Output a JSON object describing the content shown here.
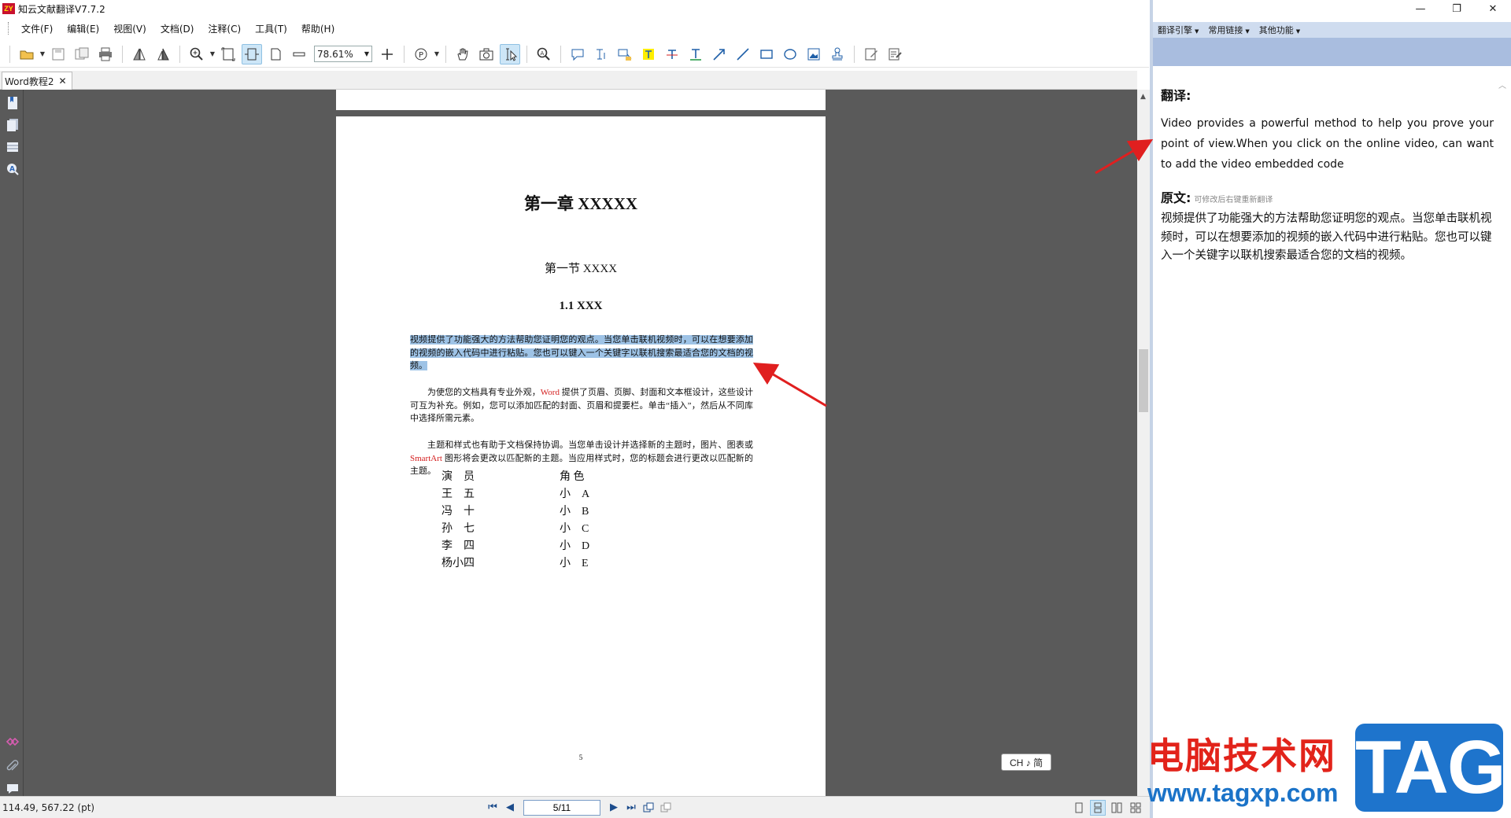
{
  "window": {
    "title": "知云文献翻译V7.7.2",
    "logo": "ZY"
  },
  "menu": [
    "文件(F)",
    "编辑(E)",
    "视图(V)",
    "文档(D)",
    "注释(C)",
    "工具(T)",
    "帮助(H)"
  ],
  "toolbar": {
    "zoom": "78.61%"
  },
  "tabs": [
    {
      "label": "Word教程2",
      "close": "✕"
    }
  ],
  "document": {
    "chapter": "第一章  XXXXX",
    "section": "第一节  XXXX",
    "subsection": "1.1 XXX",
    "p1": "视频提供了功能强大的方法帮助您证明您的观点。当您单击联机视频时，可以在想要添加的视频的嵌入代码中进行粘贴。您也可以键入一个关键字以联机搜索最适合您的文档的视频。",
    "p2_before": "为使您的文档具有专业外观，",
    "p2_red": "Word",
    "p2_after": " 提供了页眉、页脚、封面和文本框设计，这些设计可互为补充。例如，您可以添加匹配的封面、页眉和提要栏。单击“插入”，然后从不同库中选择所需元素。",
    "p3_before": "主题和样式也有助于文档保持协调。当您单击设计并选择新的主题时，图片、图表或 ",
    "p3_red": "SmartArt",
    "p3_after": " 图形将会更改以匹配新的主题。当应用样式时，您的标题会进行更改以匹配新的主题。",
    "cast": [
      [
        "演　员",
        "角 色"
      ],
      [
        "王　五",
        "小　A"
      ],
      [
        "冯　十",
        "小　B"
      ],
      [
        "孙　七",
        "小　C"
      ],
      [
        "李　四",
        "小　D"
      ],
      [
        "杨小四",
        "小　E"
      ]
    ],
    "page_number": "5"
  },
  "ime": "CH ♪ 简",
  "status": {
    "coords": "114.49, 567.22 (pt)",
    "page": "5/11"
  },
  "right_panel": {
    "menus": [
      "翻译引擎",
      "常用链接",
      "其他功能"
    ],
    "translation_heading": "翻译:",
    "translation": "Video provides a powerful method to help you prove your point of view.When you click on the online video, can want to add the video embedded code",
    "original_heading": "原文:",
    "original_hint": "可修改后右键重新翻译",
    "original": "视频提供了功能强大的方法帮助您证明您的观点。当您单击联机视频时，可以在想要添加的视频的嵌入代码中进行粘贴。您也可以键入一个关键字以联机搜索最适合您的文档的视频。"
  },
  "window_controls": {
    "minimize": "—",
    "restore": "❐",
    "close": "✕"
  },
  "watermark": {
    "text": "电脑技术网",
    "url": "www.tagxp.com",
    "tag": "TAG"
  },
  "colors": {
    "highlight": "#9ec3e6",
    "accent_red": "#d42020",
    "panel_band": "#a9bddf",
    "arrow": "#e01f1f"
  }
}
